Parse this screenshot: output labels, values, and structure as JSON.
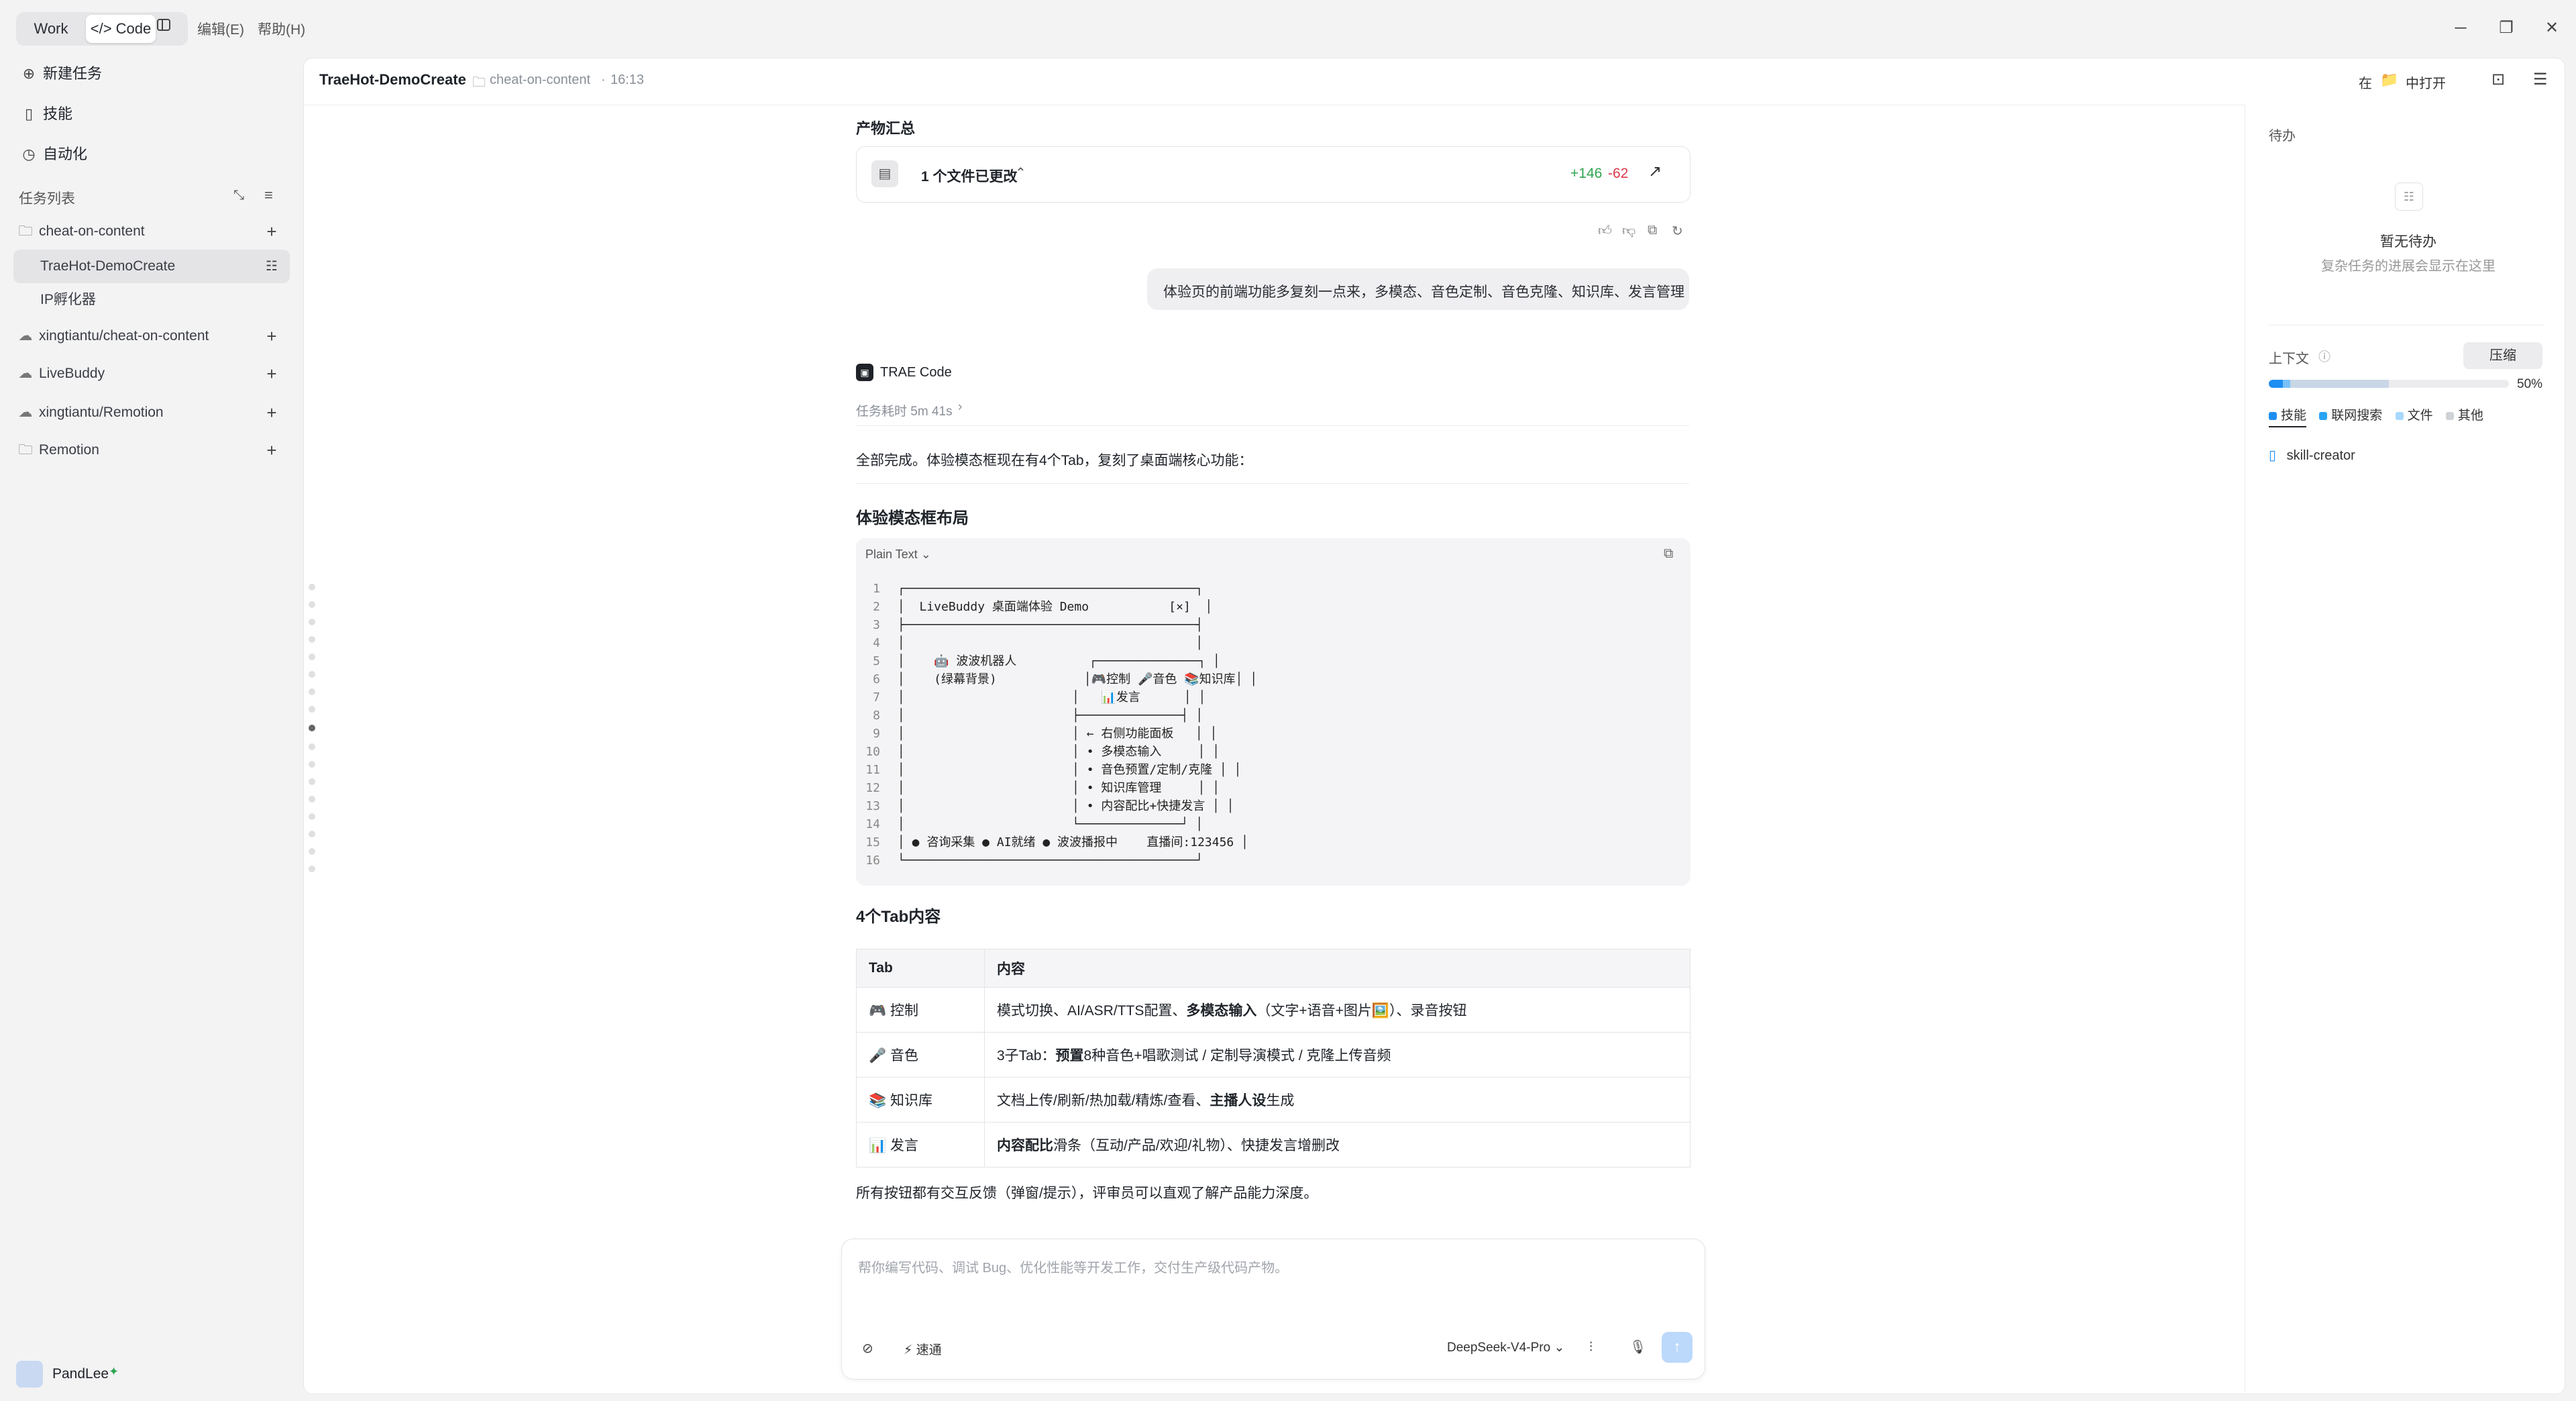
{
  "titlebar": {
    "mode_work": "Work",
    "mode_code": "Code",
    "menu_edit": "编辑(E)",
    "menu_help": "帮助(H)"
  },
  "sidebar": {
    "new_task": "新建任务",
    "skills": "技能",
    "automation": "自动化",
    "task_list_label": "任务列表",
    "tasks": [
      {
        "label": "cheat-on-content",
        "icon": "folder-icon"
      },
      {
        "label": "TraeHot-DemoCreate",
        "icon": "none"
      },
      {
        "label": "IP孵化器",
        "icon": "none"
      },
      {
        "label": "xingtiantu/cheat-on-content",
        "icon": "cloud-icon"
      },
      {
        "label": "LiveBuddy",
        "icon": "cloud-icon"
      },
      {
        "label": "xingtiantu/Remotion",
        "icon": "cloud-icon"
      },
      {
        "label": "Remotion",
        "icon": "folder-icon"
      }
    ],
    "user_name": "PandLee"
  },
  "header": {
    "title": "TraeHot-DemoCreate",
    "folder": "cheat-on-content",
    "time": "16:13",
    "open_in_prefix": "在",
    "open_in_suffix": "中打开"
  },
  "chat": {
    "artifacts_title": "产物汇总",
    "files_changed": "1 个文件已更改",
    "added": "+146",
    "removed": "-62",
    "user_message": "体验页的前端功能多复刻一点来，多模态、音色定制、音色克隆、知识库、发言管理",
    "assistant_name": "TRAE Code",
    "task_duration": "任务耗时 5m 41s",
    "summary": "全部完成。体验模态框现在有4个Tab，复刻了桌面端核心功能：",
    "layout_heading": "体验模态框布局",
    "code_lang": "Plain Text",
    "code_lines": [
      "┌────────────────────────────────────────┐",
      "│  LiveBuddy 桌面端体验 Demo           [×]  │",
      "├────────────────────────────────────────┤",
      "│                                        │",
      "│    🤖 波波机器人          ┌──────────────┐ │",
      "│    (绿幕背景)            │🎮控制 🎤音色 📚知识库│ │",
      "│                       │   📊发言      │ │",
      "│                       ├──────────────┤ │",
      "│                       │ ← 右侧功能面板   │ │",
      "│                       │ • 多模态输入     │ │",
      "│                       │ • 音色预置/定制/克隆 │ │",
      "│                       │ • 知识库管理     │ │",
      "│                       │ • 内容配比+快捷发言 │ │",
      "│                       └──────────────┘ │",
      "│ ● 咨询采集 ● AI就绪 ● 波波播报中    直播间:123456 │",
      "└────────────────────────────────────────┘"
    ],
    "tabs_heading": "4个Tab内容",
    "table_headers": [
      "Tab",
      "内容"
    ],
    "table_rows": [
      {
        "icon": "🎮",
        "tab": "控制",
        "pre": "模式切换、AI/ASR/TTS配置、",
        "bold": "多模态输入",
        "post": "（文字+语音+图片🖼️）、录音按钮"
      },
      {
        "icon": "🎤",
        "tab": "音色",
        "pre": "3子Tab：",
        "bold": "预置",
        "post": "8种音色+唱歌测试 / 定制导演模式 / 克隆上传音频"
      },
      {
        "icon": "📚",
        "tab": "知识库",
        "pre": "文档上传/刷新/热加载/精炼/查看、",
        "bold": "主播人设",
        "post": "生成"
      },
      {
        "icon": "📊",
        "tab": "发言",
        "pre": "",
        "bold": "内容配比",
        "post": "滑条（互动/产品/欢迎/礼物）、快捷发言增删改"
      }
    ],
    "closing": "所有按钮都有交互反馈（弹窗/提示），评审员可以直观了解产品能力深度。",
    "input_placeholder": "帮你编写代码、调试 Bug、优化性能等开发工作，交付生产级代码产物。",
    "mode_label": "速通",
    "model": "DeepSeek-V4-Pro"
  },
  "right_panel": {
    "todo_title": "待办",
    "todo_empty": "暂无待办",
    "todo_hint": "复杂任务的进展会显示在这里",
    "context_label": "上下文",
    "compress": "压缩",
    "context_percent": "50%",
    "context_fill": 0.5,
    "legend": [
      "技能",
      "联网搜索",
      "文件",
      "其他"
    ],
    "skill_item": "skill-creator"
  },
  "colors": {
    "accent": "#1f8ef1",
    "added": "#2ea44f",
    "removed": "#d73a49"
  }
}
